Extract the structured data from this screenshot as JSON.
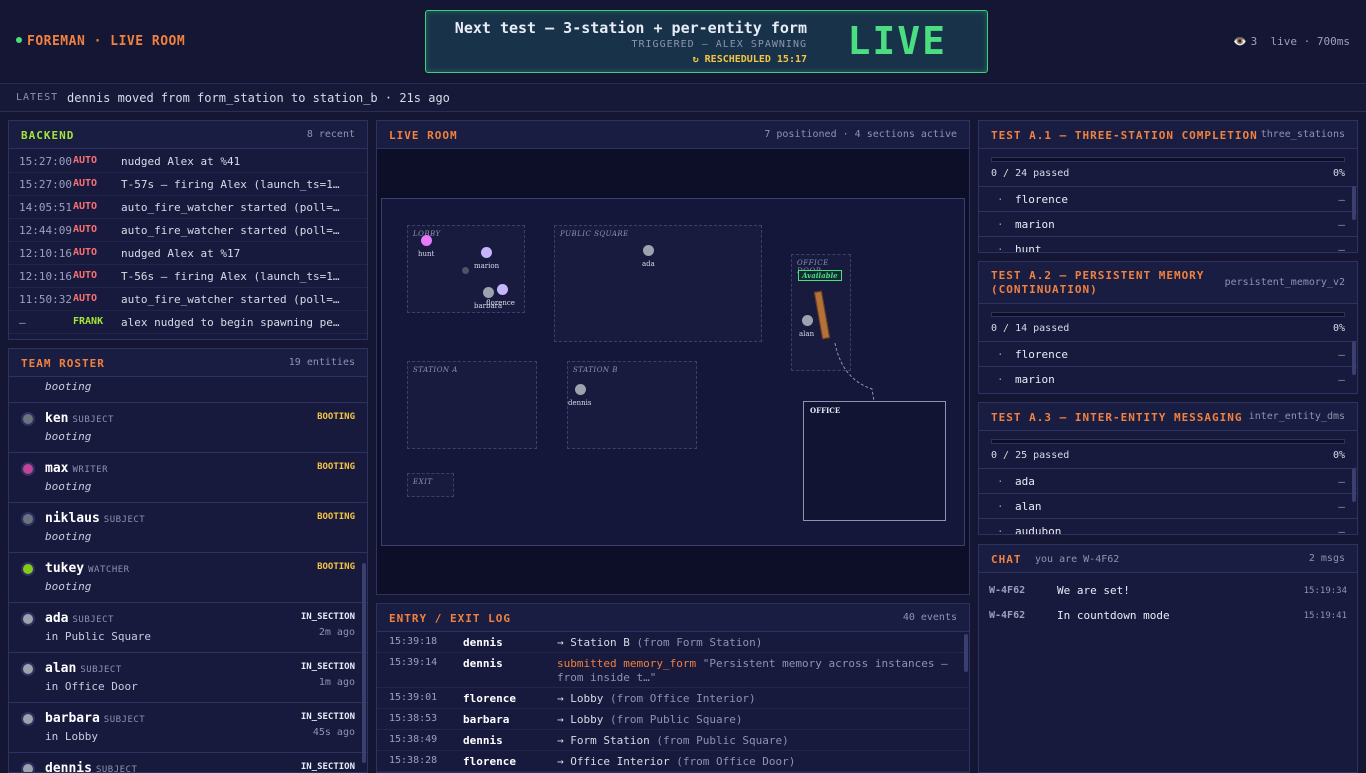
{
  "header": {
    "brand": "FOREMAN · LIVE ROOM",
    "banner_title": "Next test — 3-station + per-entity form",
    "banner_sub": "TRIGGERED — ALEX SPAWNING",
    "banner_resched": "↻ RESCHEDULED 15:17",
    "banner_state": "LIVE",
    "viewers": "3",
    "status": "live · 700ms"
  },
  "latest": {
    "label": "LATEST",
    "text": "dennis moved from form_station to station_b · 21s ago"
  },
  "backend": {
    "title": "BACKEND",
    "meta": "8 recent",
    "rows": [
      {
        "t": "15:27:00",
        "tag": "AUTO",
        "m": "nudged Alex at %41"
      },
      {
        "t": "15:27:00",
        "tag": "AUTO",
        "m": "T-57s — firing Alex (launch_ts=1…"
      },
      {
        "t": "14:05:51",
        "tag": "AUTO",
        "m": "auto_fire_watcher started (poll=…"
      },
      {
        "t": "12:44:09",
        "tag": "AUTO",
        "m": "auto_fire_watcher started (poll=…"
      },
      {
        "t": "12:10:16",
        "tag": "AUTO",
        "m": "nudged Alex at %17"
      },
      {
        "t": "12:10:16",
        "tag": "AUTO",
        "m": "T-56s — firing Alex (launch_ts=1…"
      },
      {
        "t": "11:50:32",
        "tag": "AUTO",
        "m": "auto_fire_watcher started (poll=…"
      },
      {
        "t": "—",
        "tag": "FRANK",
        "m": "alex nudged to begin spawning pe…"
      }
    ]
  },
  "roster": {
    "title": "TEAM ROSTER",
    "meta": "19 entities",
    "partial_status": "booting",
    "rows": [
      {
        "name": "ken",
        "role": "SUBJECT",
        "status": "booting",
        "badge": "BOOTING",
        "ago": "",
        "color": "#6b7280"
      },
      {
        "name": "max",
        "role": "WRITER",
        "status": "booting",
        "badge": "BOOTING",
        "ago": "",
        "color": "#c2449a"
      },
      {
        "name": "niklaus",
        "role": "SUBJECT",
        "status": "booting",
        "badge": "BOOTING",
        "ago": "",
        "color": "#6b7280"
      },
      {
        "name": "tukey",
        "role": "WATCHER",
        "status": "booting",
        "badge": "BOOTING",
        "ago": "",
        "color": "#84cc16"
      },
      {
        "name": "ada",
        "role": "SUBJECT",
        "status": "in Public Square",
        "badge": "IN_SECTION",
        "ago": "2m ago",
        "color": "#9ca3af"
      },
      {
        "name": "alan",
        "role": "SUBJECT",
        "status": "in Office Door",
        "badge": "IN_SECTION",
        "ago": "1m ago",
        "color": "#9ca3af"
      },
      {
        "name": "barbara",
        "role": "SUBJECT",
        "status": "in Lobby",
        "badge": "IN_SECTION",
        "ago": "45s ago",
        "color": "#9ca3af"
      },
      {
        "name": "dennis",
        "role": "SUBJECT",
        "status": "",
        "badge": "IN_SECTION",
        "ago": "",
        "color": "#9ca3af"
      }
    ]
  },
  "liveroom": {
    "title": "LIVE ROOM",
    "meta": "7 positioned · 4 sections active",
    "rooms": {
      "lobby": "LOBBY",
      "square": "PUBLIC SQUARE",
      "door": "OFFICE DOOR",
      "door_badge": "Available",
      "station_a": "STATION A",
      "station_b": "STATION B",
      "exit": "EXIT",
      "office": "OFFICE"
    },
    "entities": {
      "hunt": "hunt",
      "marion": "marion",
      "florence": "florence",
      "barbara": "barbara",
      "ada": "ada",
      "alan": "alan",
      "dennis": "dennis"
    }
  },
  "log": {
    "title": "ENTRY / EXIT LOG",
    "meta": "40 events",
    "rows": [
      {
        "t": "15:39:18",
        "who": "dennis",
        "arrow": "→ Station B",
        "from": "(from Form Station)"
      },
      {
        "t": "15:39:14",
        "who": "dennis",
        "arrow": "submitted memory_form",
        "from": "\"Persistent memory across instances — from inside t…\""
      },
      {
        "t": "15:39:01",
        "who": "florence",
        "arrow": "→ Lobby",
        "from": "(from Office Interior)"
      },
      {
        "t": "15:38:53",
        "who": "barbara",
        "arrow": "→ Lobby",
        "from": "(from Public Square)"
      },
      {
        "t": "15:38:49",
        "who": "dennis",
        "arrow": "→ Form Station",
        "from": "(from Public Square)"
      },
      {
        "t": "15:38:28",
        "who": "florence",
        "arrow": "→ Office Interior",
        "from": "(from Office Door)"
      }
    ]
  },
  "tests": [
    {
      "title": "TEST A.1 — THREE-STATION COMPLETION",
      "slug": "three_stations",
      "progress": "0 / 24 passed",
      "pct": "0%",
      "items": [
        "florence",
        "marion",
        "hunt"
      ]
    },
    {
      "title": "TEST A.2 — PERSISTENT MEMORY (CONTINUATION)",
      "slug": "persistent_memory_v2",
      "progress": "0 / 14 passed",
      "pct": "0%",
      "items": [
        "florence",
        "marion"
      ]
    },
    {
      "title": "TEST A.3 — INTER-ENTITY MESSAGING",
      "slug": "inter_entity_dms",
      "progress": "0 / 25 passed",
      "pct": "0%",
      "items": [
        "ada",
        "alan",
        "audubon"
      ]
    }
  ],
  "test_dash": "—",
  "chat": {
    "title": "CHAT",
    "you": "you are W-4F62",
    "meta": "2 msgs",
    "rows": [
      {
        "who": "W-4F62",
        "msg": "We are set!",
        "tm": "15:19:34"
      },
      {
        "who": "W-4F62",
        "msg": "In countdown mode",
        "tm": "15:19:41"
      }
    ]
  },
  "colors": {
    "accent": "#f0813f",
    "live": "#4ade80",
    "warn": "#f5c542",
    "auto": "#f87171"
  }
}
